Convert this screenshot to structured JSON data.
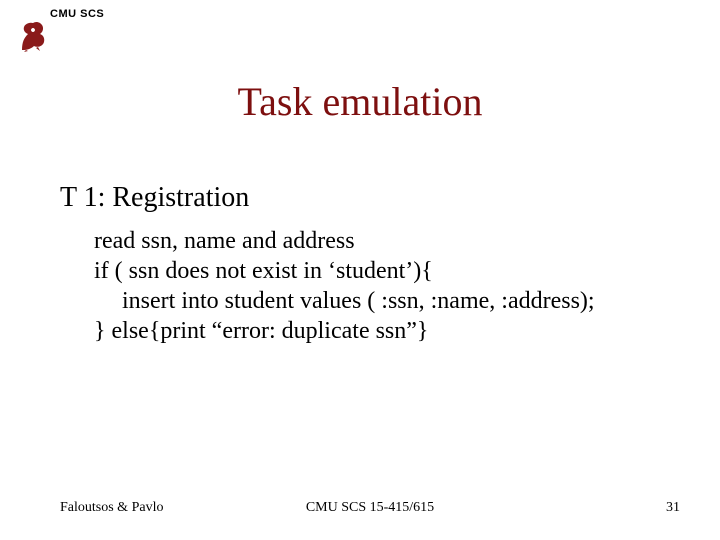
{
  "header": {
    "org_label": "CMU SCS"
  },
  "title": "Task emulation",
  "subtitle": "T 1: Registration",
  "body": {
    "line1": "read ssn, name and address",
    "line2": "if ( ssn does not exist in ‘student’){",
    "line3": "insert into student values ( :ssn, :name, :address);",
    "line4": "} else{print “error: duplicate ssn”}"
  },
  "footer": {
    "left": "Faloutsos & Pavlo",
    "center": "CMU SCS 15-415/615",
    "right": "31"
  },
  "colors": {
    "title": "#7d0f0f",
    "logo": "#8a1a1a"
  }
}
